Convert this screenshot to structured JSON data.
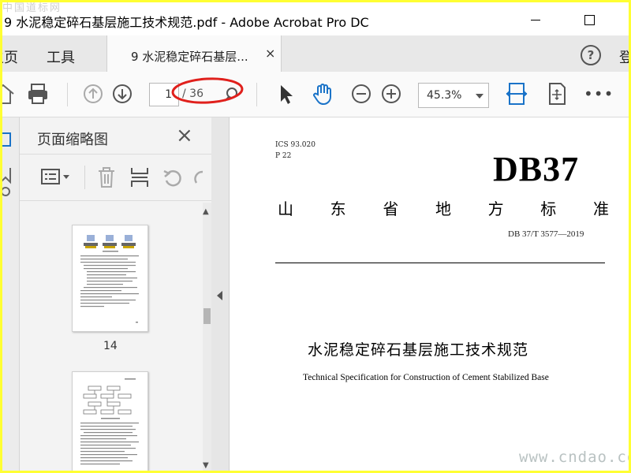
{
  "window": {
    "title": "9 水泥稳定碎石基层施工技术规范.pdf - Adobe Acrobat Pro DC",
    "watermark_top": "中国道标网"
  },
  "tabs": {
    "home": "主页",
    "tools": "工具",
    "document": "9 水泥稳定碎石基层...",
    "close_glyph": "×",
    "help": "?",
    "signin": "登"
  },
  "toolbar": {
    "page_current": "1",
    "page_total": "/ 36",
    "zoom": "45.3%",
    "more": "•••",
    "annotation_color": "#e0201c",
    "accent": "#1a73c8"
  },
  "panel": {
    "title": "页面缩略图",
    "close": "×",
    "thumbnails": [
      {
        "label": "14"
      },
      {
        "label": ""
      }
    ]
  },
  "document": {
    "ics": "ICS 93.020",
    "p": "P 22",
    "code": "DB37",
    "std_chars": [
      "山",
      "东",
      "省",
      "地",
      "方",
      "标",
      "准"
    ],
    "std_number": "DB 37/T 3577—2019",
    "title_cn": "水泥稳定碎石基层施工技术规范",
    "title_en": "Technical Specification for Construction of Cement Stabilized Base"
  },
  "watermark_bottom": "www.cndao.com"
}
